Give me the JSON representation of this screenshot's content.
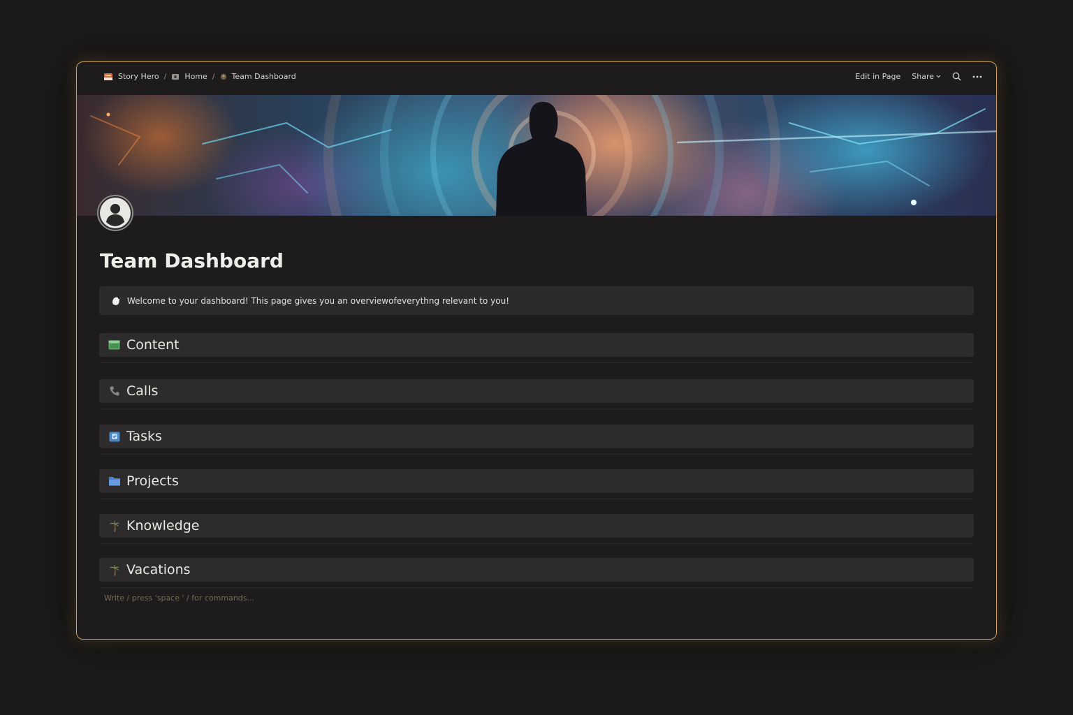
{
  "breadcrumb": {
    "items": [
      {
        "label": "Story Hero",
        "icon": "story-hero-icon"
      },
      {
        "label": "Home",
        "icon": "home-icon"
      },
      {
        "label": "Team Dashboard",
        "icon": "team-dashboard-icon"
      }
    ],
    "separator": "/"
  },
  "actions": {
    "edit_label": "Edit in Page",
    "share_label": "Share"
  },
  "page": {
    "title": "Team Dashboard",
    "callout": {
      "icon": "wave-hand-icon",
      "text": "Welcome to your dashboard! This page gives you an overviewofeverythng relevant to you!"
    },
    "sections": [
      {
        "label": "Content",
        "icon": "content-icon"
      },
      {
        "label": "Calls",
        "icon": "phone-icon"
      },
      {
        "label": "Tasks",
        "icon": "tasks-icon"
      },
      {
        "label": "Projects",
        "icon": "folder-icon"
      },
      {
        "label": "Knowledge",
        "icon": "palm-tree-icon"
      },
      {
        "label": "Vacations",
        "icon": "palm-tree-icon"
      }
    ],
    "placeholder": "Write / press 'space ' / for commands..."
  },
  "colors": {
    "background": "#1c1a1a",
    "window": "#1d1b1b",
    "frame": "#c9a15f",
    "section_bg": "#2d2b2b"
  }
}
